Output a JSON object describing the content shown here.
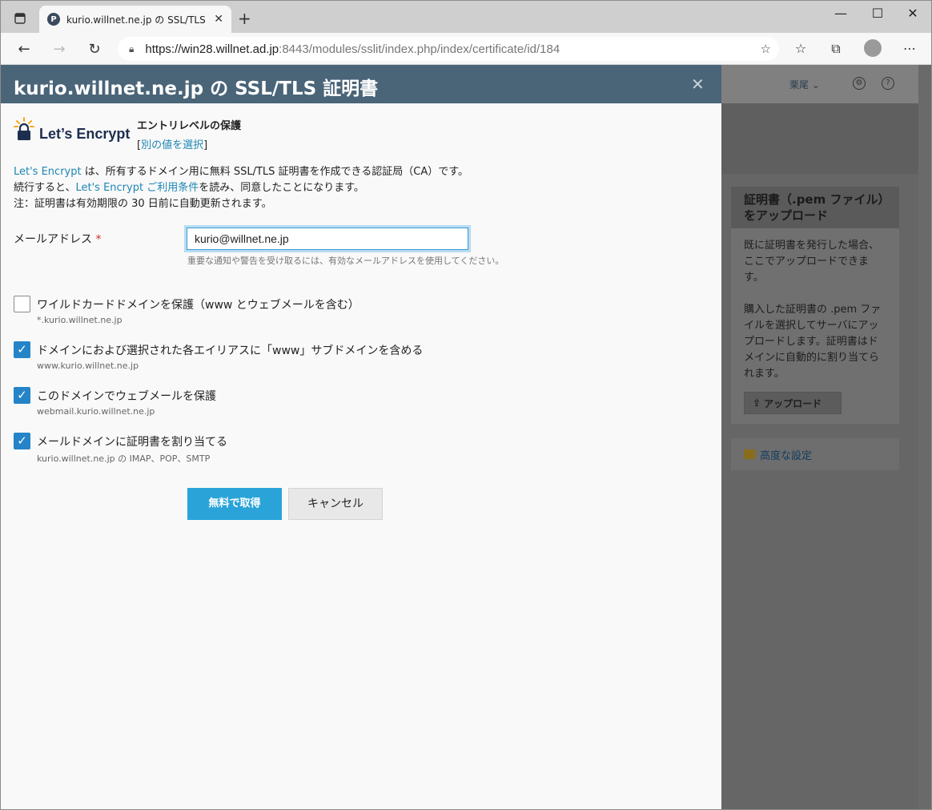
{
  "browser": {
    "tab_title": "kurio.willnet.ne.jp の SSL/TLS 証明",
    "favicon_letter": "P",
    "url_host": "https://win28.willnet.ad.jp",
    "url_rest": ":8443/modules/sslit/index.php/index/certificate/id/184"
  },
  "background": {
    "user_label": "栗尾 ⌄",
    "help_badge": "?",
    "card_title": "証明書（.pem ファイル）をアップロード",
    "card_text_1": "既に証明書を発行した場合、ここでアップロードできます。",
    "card_text_2": "購入した証明書の .pem ファイルを選択してサーバにアップロードします。証明書はドメインに自動的に割り当てられます。",
    "upload_label": "アップロード",
    "advanced_label": "高度な設定"
  },
  "dialog": {
    "title": "kurio.willnet.ne.jp の SSL/TLS 証明書",
    "logo_text": "Let’s Encrypt",
    "level_label": "エントリレベルの保護",
    "choose_other_prefix": "[",
    "choose_other": "別の値を選択",
    "choose_other_suffix": "]",
    "desc_line1_link": "Let's Encrypt",
    "desc_line1_rest": " は、所有するドメイン用に無料 SSL/TLS 証明書を作成できる認証局（CA）です。",
    "desc_line2_pre": "続行すると、",
    "desc_line2_link": "Let's Encrypt ご利用条件",
    "desc_line2_post": "を読み、同意したことになります。",
    "desc_line3": "注：証明書は有効期限の 30 日前に自動更新されます。",
    "email_label": "メールアドレス",
    "required_mark": "*",
    "email_value": "kurio@willnet.ne.jp",
    "email_hint": "重要な通知や警告を受け取るには、有効なメールアドレスを使用してください。",
    "options": [
      {
        "label": "ワイルドカードドメインを保護（www とウェブメールを含む）",
        "sub": "*.kurio.willnet.ne.jp",
        "checked": false
      },
      {
        "label": "ドメインにおよび選択された各エイリアスに「www」サブドメインを含める",
        "sub": "www.kurio.willnet.ne.jp",
        "checked": true
      },
      {
        "label": "このドメインでウェブメールを保護",
        "sub": "webmail.kurio.willnet.ne.jp",
        "checked": true
      },
      {
        "label": "メールドメインに証明書を割り当てる",
        "sub": "kurio.willnet.ne.jp の IMAP、POP、SMTP",
        "checked": true
      }
    ],
    "submit_label": "無料で取得",
    "cancel_label": "キャンセル"
  },
  "colors": {
    "header": "#4a6478",
    "primary_button": "#2aa4d8",
    "link": "#1e86b4",
    "checkbox": "#2584c7"
  }
}
